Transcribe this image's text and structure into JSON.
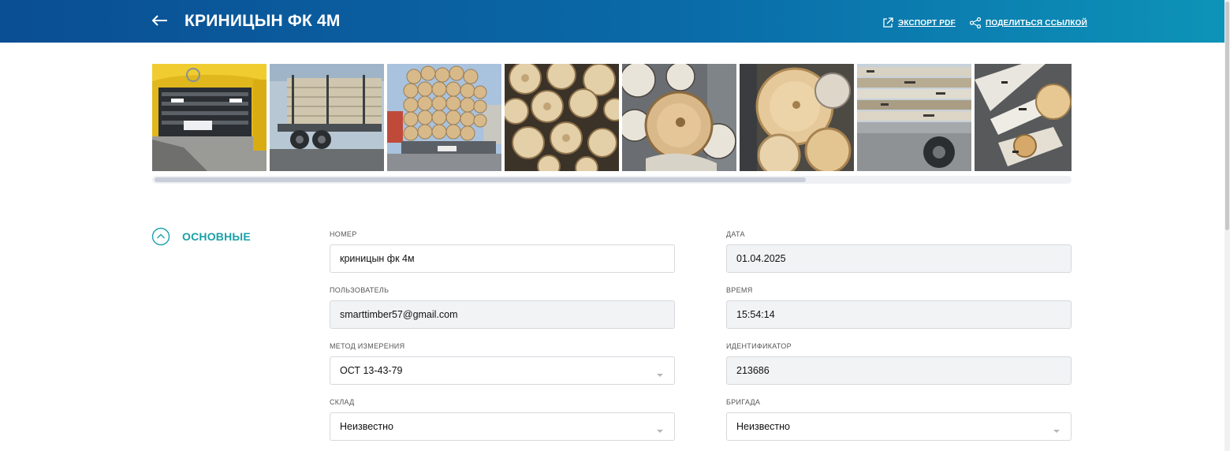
{
  "header": {
    "title": "КРИНИЦЫН ФК 4М",
    "export_pdf_label": "ЭКСПОРТ PDF",
    "share_link_label": "ПОДЕЛИТЬСЯ ССЫЛКОЙ"
  },
  "gallery": {
    "photos": [
      {
        "subject": "truck cab front"
      },
      {
        "subject": "timber truck side"
      },
      {
        "subject": "log stack rear"
      },
      {
        "subject": "log ends close-up"
      },
      {
        "subject": "birch log ends"
      },
      {
        "subject": "log cross-section"
      },
      {
        "subject": "log load side"
      },
      {
        "subject": "birch logs close-up"
      }
    ],
    "scroll_position": 0.71
  },
  "section": {
    "title": "ОСНОВНЫЕ"
  },
  "fields": {
    "number": {
      "label": "НОМЕР",
      "value": "криницын фк 4м"
    },
    "date": {
      "label": "ДАТА",
      "value": "01.04.2025"
    },
    "user": {
      "label": "ПОЛЬЗОВАТЕЛЬ",
      "value": "smarttimber57@gmail.com"
    },
    "time": {
      "label": "ВРЕМЯ",
      "value": "15:54:14"
    },
    "method": {
      "label": "МЕТОД ИЗМЕРЕНИЯ",
      "value": "ОСТ 13-43-79"
    },
    "identifier": {
      "label": "ИДЕНТИФИКАТОР",
      "value": "213686"
    },
    "warehouse": {
      "label": "СКЛАД",
      "value": "Неизвестно"
    },
    "brigade": {
      "label": "БРИГАДА",
      "value": "Неизвестно"
    }
  },
  "colors": {
    "header_start": "#0a4e93",
    "header_end": "#0d93b8",
    "accent": "#1aa0a8"
  }
}
